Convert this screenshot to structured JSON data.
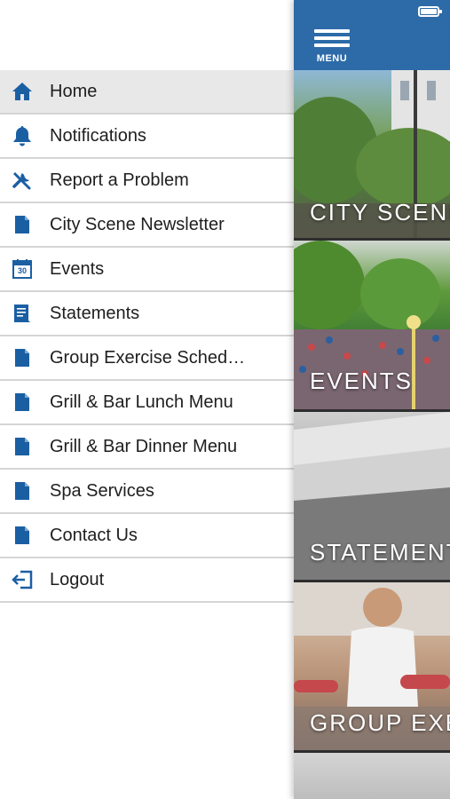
{
  "menu": {
    "items": [
      {
        "label": "Home",
        "icon": "home-icon",
        "active": true
      },
      {
        "label": "Notifications",
        "icon": "bell-icon"
      },
      {
        "label": "Report a Problem",
        "icon": "tools-icon"
      },
      {
        "label": "City Scene Newsletter",
        "icon": "document-icon"
      },
      {
        "label": "Events",
        "icon": "calendar-icon",
        "calendar_day": "30"
      },
      {
        "label": "Statements",
        "icon": "statement-icon"
      },
      {
        "label": "Group Exercise Sched…",
        "icon": "document-icon"
      },
      {
        "label": "Grill & Bar Lunch Menu",
        "icon": "document-icon"
      },
      {
        "label": "Grill & Bar Dinner Menu",
        "icon": "document-icon"
      },
      {
        "label": "Spa Services",
        "icon": "document-icon"
      },
      {
        "label": "Contact Us",
        "icon": "document-icon"
      },
      {
        "label": "Logout",
        "icon": "logout-icon"
      }
    ]
  },
  "topbar": {
    "menu_label": "MENU"
  },
  "tiles": [
    {
      "label": "CITY SCENE"
    },
    {
      "label": "EVENTS"
    },
    {
      "label": "STATEMENTS"
    },
    {
      "label": "GROUP EXERCISE"
    }
  ],
  "colors": {
    "brand_blue": "#2d6aa8",
    "icon_blue": "#1b5fa3",
    "active_row": "#e8e8e8",
    "divider": "#d5d5d5"
  }
}
